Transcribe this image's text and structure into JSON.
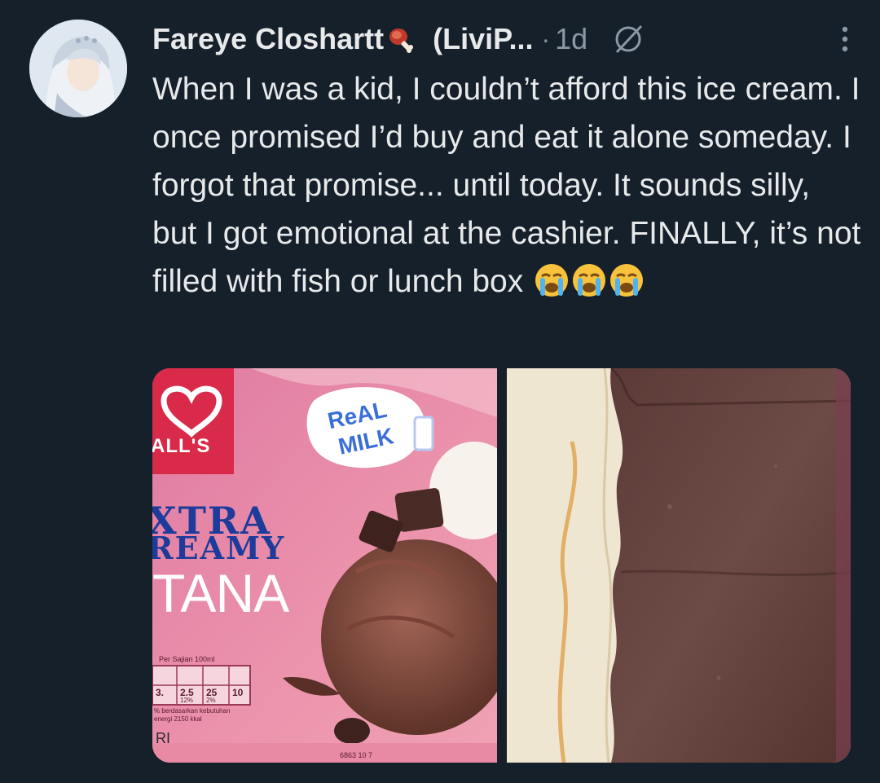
{
  "post": {
    "author_name": "Fareye Closhartt",
    "author_badge_icon": "meat-on-bone-icon",
    "handle": "(LiviP...",
    "separator": "·",
    "timestamp": "1d",
    "grok_icon": "grok-icon",
    "more_icon": "more-vertical-icon",
    "text": "When I was a kid, I couldn’t afford this ice cream. I once promised I’d buy and eat it alone someday. I forgot that promise... until today. It sounds silly, but I got emotional at the cashier. FINALLY, it’s not filled with fish or lunch box",
    "emojis": [
      "loudly-crying-face-icon",
      "loudly-crying-face-icon",
      "loudly-crying-face-icon"
    ]
  },
  "media": {
    "left_photo": {
      "brand": "ALL'S",
      "line1": "XTRA",
      "line2": "REAMY",
      "product": "TANA",
      "badge_line1": "ReAL",
      "badge_line2": "MILK",
      "nutrition_header": "Per Sajian 100ml",
      "nutrition_values": [
        "3.",
        "2.5",
        "25",
        "10"
      ],
      "nutrition_pcts": [
        "12%",
        "2%"
      ],
      "footnote_line1": "% berdasarkan kebutuhan",
      "footnote_line2": "energi 2150 kkal",
      "corner_text": "RI",
      "barcode_text": "6863 10 7"
    },
    "right_photo": {}
  },
  "colors": {
    "background": "#15202b",
    "text_primary": "#e7e9ea",
    "text_secondary": "#8b98a5",
    "package_pink": "#e98aa5",
    "chocolate": "#5e3f3b",
    "vanilla": "#efe6d4"
  }
}
